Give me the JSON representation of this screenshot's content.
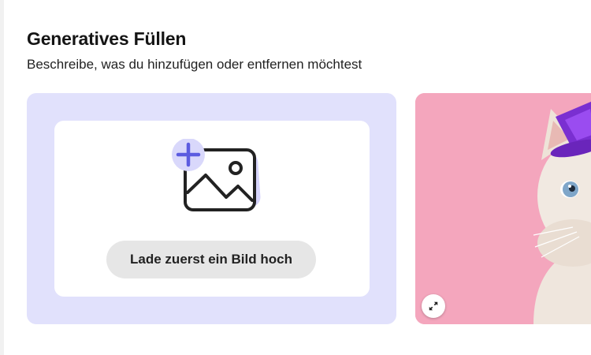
{
  "header": {
    "title": "Generatives Füllen",
    "subtitle": "Beschreibe, was du hinzufügen oder entfernen möchtest"
  },
  "upload": {
    "icon": "image-add-icon",
    "button_label": "Lade zuerst ein Bild hoch"
  },
  "sample": {
    "image": "cat-with-purple-hat-image",
    "expand_icon": "expand-icon"
  },
  "colors": {
    "panel_background": "#e1e1fc",
    "icon_accent": "#5c5ce0",
    "sample_background": "#f4a6bd",
    "hat": "#7a2fd1"
  }
}
